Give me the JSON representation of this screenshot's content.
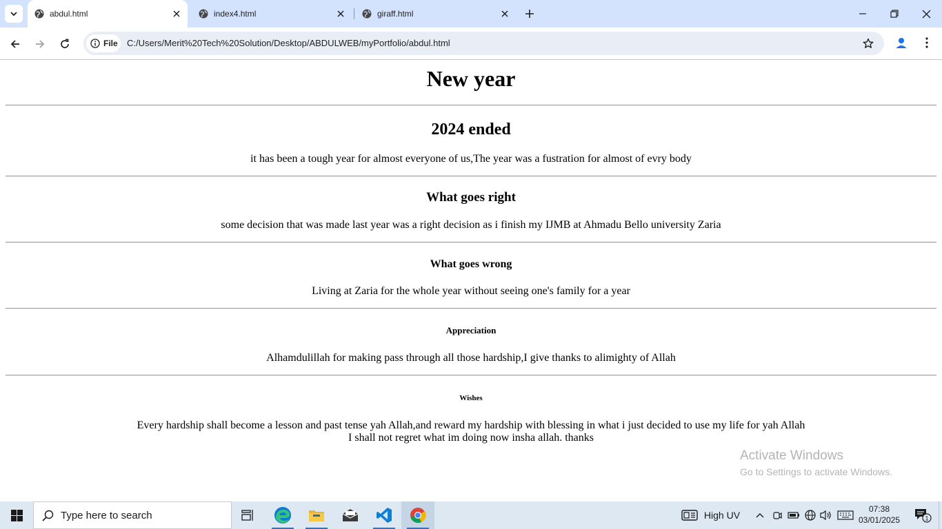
{
  "browser": {
    "tabs": [
      {
        "title": "abdul.html",
        "active": true
      },
      {
        "title": "index4.html",
        "active": false
      },
      {
        "title": "giraff.html",
        "active": false
      }
    ],
    "address_bar": {
      "chip_label": "File",
      "url": "C:/Users/Merit%20Tech%20Solution/Desktop/ABDULWEB/myPortfolio/abdul.html"
    },
    "accent_color": "#d3e3fd"
  },
  "page": {
    "title": "New year",
    "sections": [
      {
        "heading": "2024 ended",
        "text": "it has been a tough year for almost everyone of us,The year was a fustration for almost of evry body"
      },
      {
        "heading": "What goes right",
        "text": "some decision that was made last year was a right decision as i finish my IJMB at Ahmadu Bello university Zaria"
      },
      {
        "heading": "What goes wrong",
        "text": "Living at Zaria for the whole year without seeing one's family for a year"
      },
      {
        "heading": "Appreciation",
        "text": "Alhamdulillah for making pass through all those hardship,I give thanks to alimighty of Allah"
      },
      {
        "heading": "Wishes",
        "text_line1": "Every hardship shall become a lesson and past tense yah Allah,and reward my hardship with blessing in what i just decided to use my life for yah Allah",
        "text_line2": "I shall not regret what im doing now insha allah. thanks"
      }
    ]
  },
  "watermark": {
    "title": "Activate Windows",
    "subtitle": "Go to Settings to activate Windows."
  },
  "taskbar": {
    "search_placeholder": "Type here to search",
    "weather": "High UV",
    "time": "07:38",
    "date": "03/01/2025",
    "notification_count": "1",
    "apps": [
      "task-view",
      "edge",
      "file-explorer",
      "mail",
      "vscode",
      "chrome"
    ]
  }
}
